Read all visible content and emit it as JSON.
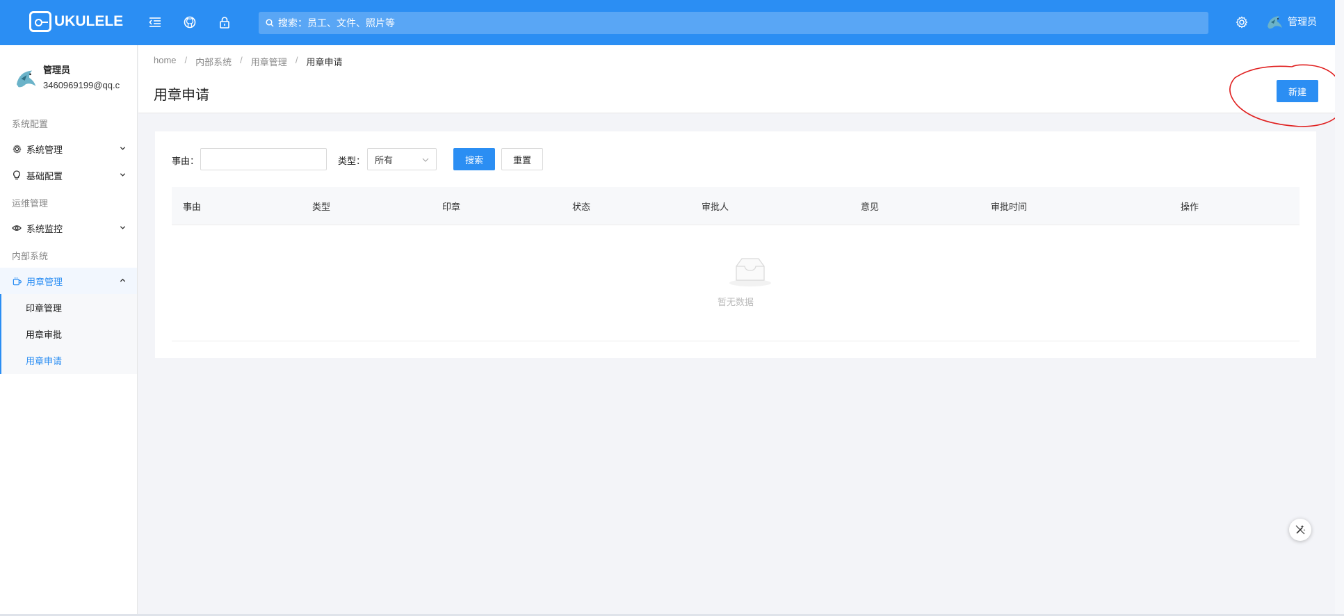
{
  "header": {
    "logo_text": "UKULELE",
    "search_placeholder": "搜索：员工、文件、照片等",
    "user_name": "管理员",
    "icons": [
      "menu-fold-icon",
      "github-icon",
      "lock-icon",
      "gear-icon"
    ]
  },
  "sidebar": {
    "profile": {
      "name": "管理员",
      "email": "3460969199@qq.c"
    },
    "groups": {
      "g1": "系统配置",
      "g2": "运维管理",
      "g3": "内部系统"
    },
    "menus": {
      "system_manage": "系统管理",
      "basic_config": "基础配置",
      "system_monitor": "系统监控",
      "seal_manage_group": "用章管理"
    },
    "submenu": {
      "seal_manage": "印章管理",
      "seal_approve": "用章审批",
      "seal_apply": "用章申请"
    }
  },
  "breadcrumb": {
    "home": "home",
    "sep": "/",
    "b2": "内部系统",
    "b3": "用章管理",
    "b4": "用章申请"
  },
  "page": {
    "title": "用章申请",
    "new_button": "新建"
  },
  "filters": {
    "reason_label": "事由：",
    "reason_value": "",
    "type_label": "类型：",
    "type_selected": "所有",
    "search_button": "搜索",
    "reset_button": "重置"
  },
  "table": {
    "columns": [
      "事由",
      "类型",
      "印章",
      "状态",
      "审批人",
      "意见",
      "审批时间",
      "操作"
    ],
    "empty_text": "暂无数据"
  },
  "colors": {
    "primary": "#2b8ef3",
    "annotation": "#e02020"
  }
}
